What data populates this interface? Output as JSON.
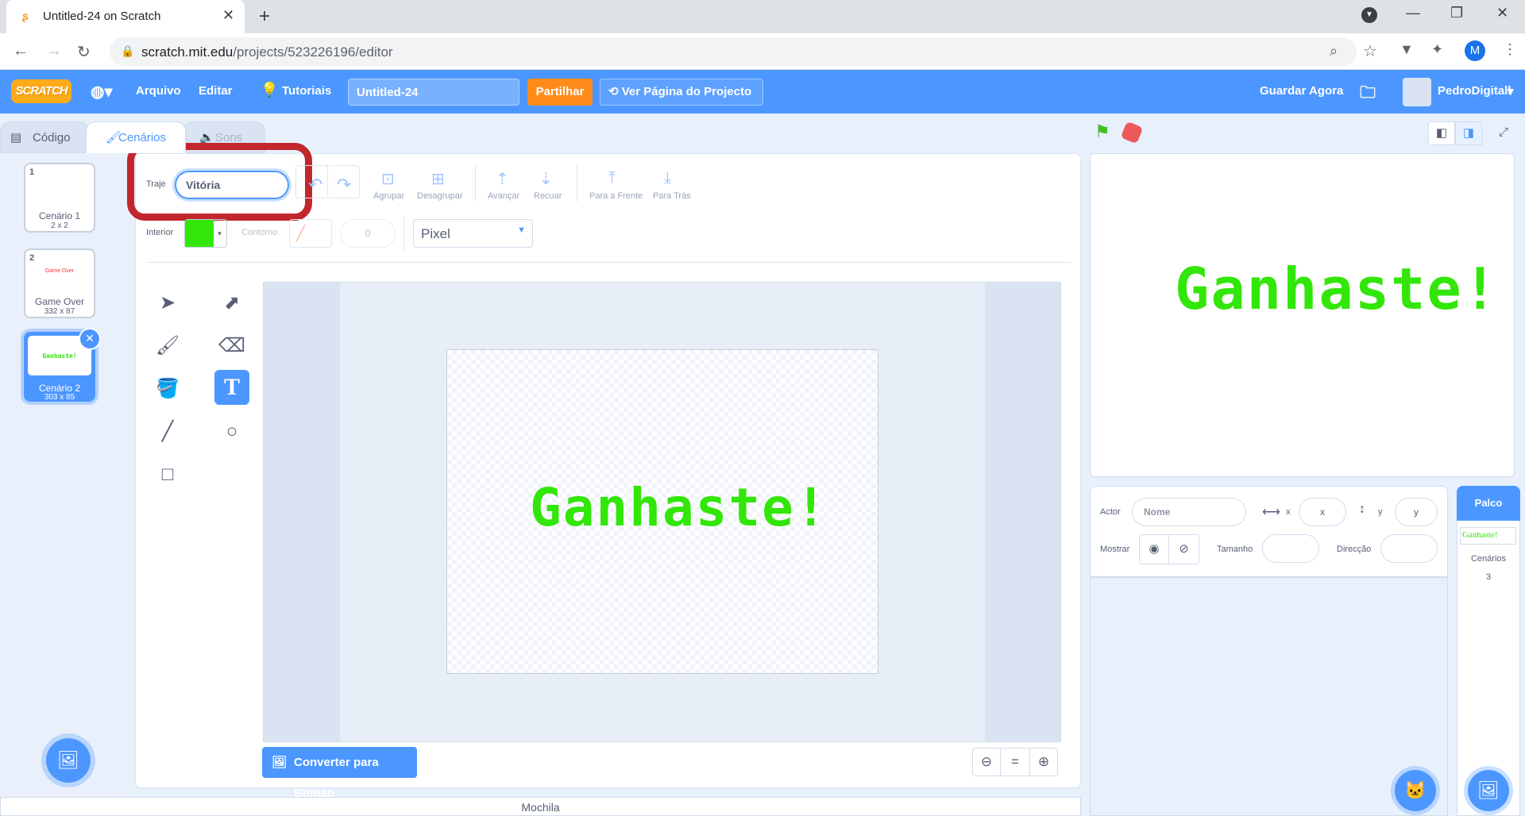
{
  "browser": {
    "tab_title": "Untitled-24 on Scratch",
    "url_host": "scratch.mit.edu",
    "url_path": "/projects/523226196/editor",
    "profile_initial": "M"
  },
  "menu": {
    "logo": "SCRATCH",
    "file": "Arquivo",
    "edit": "Editar",
    "tutorials": "Tutoriais",
    "project_title": "Untitled-24",
    "share": "Partilhar",
    "see_page": "Ver Página do Projecto",
    "save_now": "Guardar Agora",
    "username": "PedroDigitall"
  },
  "editor_tabs": {
    "code": "Código",
    "costumes": "Cenários",
    "sounds": "Sons"
  },
  "costumes": [
    {
      "index": "1",
      "name": "Cenário 1",
      "size": "2 x 2",
      "preview": ""
    },
    {
      "index": "2",
      "name": "Game Over",
      "size": "332 x 87",
      "preview": "Game Over"
    },
    {
      "index": "3",
      "name": "Cenário 2",
      "size": "303 x 85",
      "preview": "Ganhaste!"
    }
  ],
  "paint": {
    "costume_label": "Traje",
    "costume_name": "Vitória",
    "group": "Agrupar",
    "ungroup": "Desagrupar",
    "forward": "Avançar",
    "backward": "Recuar",
    "front": "Para a Frente",
    "back": "Para Trás",
    "fill_label": "Interior",
    "fill_color": "#33e60a",
    "outline_label": "Contorno",
    "outline_width": "0",
    "font": "Pixel",
    "canvas_text": "Ganhaste!",
    "convert_bitmap": "Converter para Bitmap",
    "zoom_reset": "="
  },
  "stage": {
    "text": "Ganhaste!"
  },
  "sprite_info": {
    "sprite_label": "Actor",
    "name_placeholder": "Nome",
    "x_label": "x",
    "x_placeholder": "x",
    "y_label": "y",
    "y_placeholder": "y",
    "show_label": "Mostrar",
    "size_label": "Tamanho",
    "direction_label": "Direcção"
  },
  "stage_panel": {
    "title": "Palco",
    "thumb_text": "Ganhaste!",
    "backdrops_label": "Cenários",
    "backdrops_count": "3"
  },
  "backpack": "Mochila",
  "colors": {
    "accent": "#4c97ff",
    "share": "#ff8c1a",
    "highlight": "#c1272d",
    "green_text": "#33e60a"
  }
}
